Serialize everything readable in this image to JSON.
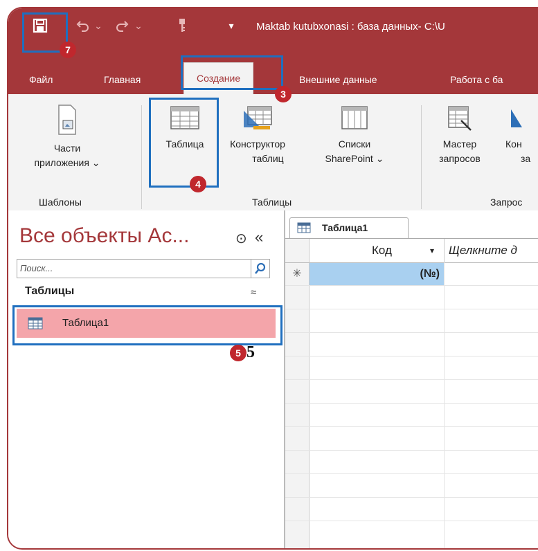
{
  "titlebar": {
    "title": "Maktab kutubxonasi : база данных- C:\\U",
    "qat_dropdown": "▾",
    "undo_caret": "⌄",
    "redo_caret": "⌄"
  },
  "tabs": [
    {
      "label": "Файл"
    },
    {
      "label": "Главная"
    },
    {
      "label": "Создание"
    },
    {
      "label": "Внешние данные"
    },
    {
      "label": "Работа с ба"
    }
  ],
  "ribbon": {
    "app_parts": {
      "line1": "Части",
      "line2": "приложения ⌄"
    },
    "table": {
      "line1": "Таблица"
    },
    "table_designer": {
      "line1": "Конструктор",
      "line2": "таблиц"
    },
    "sharepoint": {
      "line1": "Списки",
      "line2": "SharePoint ⌄"
    },
    "query_wizard": {
      "line1": "Мастер",
      "line2": "запросов"
    },
    "query_designer": {
      "line1": "Кон",
      "line2": "за"
    },
    "groups": {
      "templates": "Шаблоны",
      "tables": "Таблицы",
      "queries": "Запрос"
    }
  },
  "nav": {
    "title": "Все объекты Ac...",
    "menu_icon": "⊙",
    "collapse": "«",
    "search_placeholder": "Поиск...",
    "section": "Таблицы",
    "section_toggle": "≈",
    "item": "Таблица1"
  },
  "document": {
    "tab_label": "Таблица1",
    "col1": "Код",
    "col1_arrow": "▾",
    "col2": "Щелкните д",
    "new_row_marker": "✳",
    "autonumber": "(№)"
  },
  "badges": {
    "b3": "3",
    "b4": "4",
    "b5": "5",
    "b5_text": "5",
    "b7": "7"
  },
  "colors": {
    "accent": "#a4373a",
    "highlight": "#1f6fbf",
    "badge": "#c0272d",
    "selected_item": "#f4a5aa",
    "new_row": "#a9d0f0"
  }
}
